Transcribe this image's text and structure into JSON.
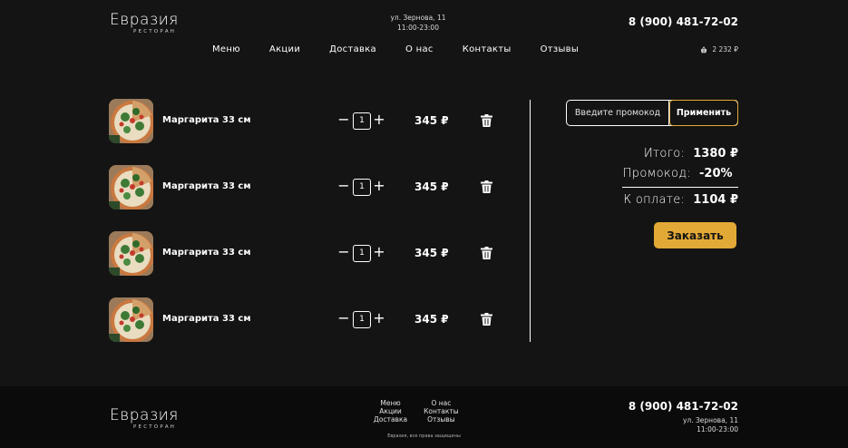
{
  "brand": {
    "name": "Евразия",
    "subtitle": "РЕСТОРАН"
  },
  "header": {
    "address": "ул. Зернова, 11",
    "hours": "11:00-23:00",
    "phone": "8 (900) 481-72-02",
    "nav": [
      "Меню",
      "Акции",
      "Доставка",
      "О нас",
      "Контакты",
      "Отзывы"
    ],
    "cart_total": "2 232 ₽",
    "cart_icon": "basket-icon"
  },
  "cart": {
    "items": [
      {
        "name": "Маргарита 33 см",
        "qty": "1",
        "price": "345 ₽"
      },
      {
        "name": "Маргарита 33 см",
        "qty": "1",
        "price": "345 ₽"
      },
      {
        "name": "Маргарита 33 см",
        "qty": "1",
        "price": "345 ₽"
      },
      {
        "name": "Маргарита 33 см",
        "qty": "1",
        "price": "345 ₽"
      }
    ],
    "minus_symbol": "−",
    "plus_symbol": "+",
    "delete_icon": "trash-icon"
  },
  "promo": {
    "placeholder": "Введите промокод",
    "apply_label": "Применить"
  },
  "summary": {
    "total_label": "Итого:",
    "total_value": "1380 ₽",
    "promo_label": "Промокод:",
    "promo_value": "-20%",
    "pay_label": "К оплате:",
    "pay_value": "1104 ₽",
    "order_label": "Заказать"
  },
  "footer": {
    "links_col1": [
      "Меню",
      "Акции",
      "Доставка"
    ],
    "links_col2": [
      "О нас",
      "Контакты",
      "Отзывы"
    ],
    "copyright": "Евразия, все права защищены",
    "phone": "8 (900) 481-72-02",
    "address": "ул. Зернова, 11",
    "hours": "11:00-23:00"
  },
  "colors": {
    "background": "#141414",
    "footer": "#0b0b0b",
    "accent": "#e3a936",
    "text": "#ffffff"
  }
}
